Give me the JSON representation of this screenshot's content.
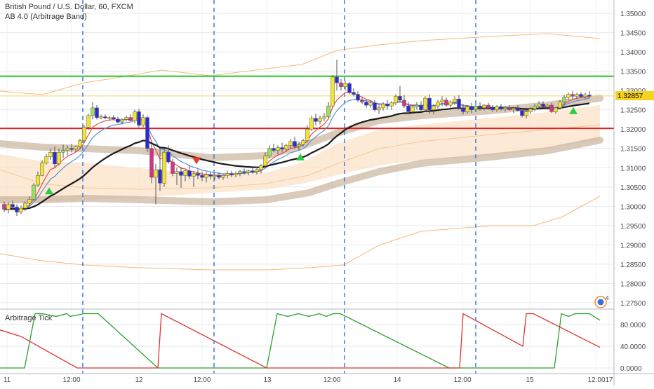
{
  "chart_data": [
    {
      "type": "candlestick",
      "title": "British Pound / U.S. Dollar, 60, FXCM",
      "study_label": "AB 4.0 (Arbitrage Band)",
      "ylim": [
        1.2735,
        1.3535
      ],
      "y_ticks": [
        "1.35000",
        "1.34500",
        "1.34000",
        "1.33500",
        "1.33000",
        "1.32500",
        "1.32000",
        "1.31500",
        "1.31000",
        "1.30500",
        "1.30000",
        "1.29500",
        "1.29000",
        "1.28500",
        "1.28000",
        "1.27500"
      ],
      "x_ticks": [
        "11",
        "12:00",
        "12",
        "12:00",
        "13",
        "12:00",
        "14",
        "12:00",
        "15",
        "12:00",
        "17"
      ],
      "last_price_label": "1.32857",
      "last_price": 1.32857,
      "horizontal_lines": [
        {
          "price": 1.3337,
          "color": "#22cc22"
        },
        {
          "price": 1.3202,
          "color": "#e02020"
        },
        {
          "price": 1.3286,
          "color": "#f5d66a"
        }
      ],
      "session_breaks_x": [
        118,
        305,
        491,
        678
      ],
      "signals": [
        {
          "type": "buy",
          "x": 70,
          "price": 1.304
        },
        {
          "type": "sell",
          "x": 280,
          "price": 1.3118
        },
        {
          "type": "buy",
          "x": 428,
          "price": 1.3128
        },
        {
          "type": "buy",
          "x": 817,
          "price": 1.3248
        }
      ],
      "candles_x": [
        6,
        12,
        18,
        24,
        30,
        36,
        42,
        48,
        54,
        60,
        66,
        72,
        78,
        84,
        90,
        96,
        102,
        108,
        114,
        120,
        126,
        132,
        138,
        144,
        150,
        156,
        162,
        168,
        174,
        180,
        186,
        192,
        198,
        204,
        210,
        216,
        222,
        228,
        234,
        240,
        246,
        252,
        258,
        264,
        270,
        276,
        282,
        288,
        294,
        300,
        306,
        312,
        318,
        324,
        330,
        336,
        342,
        348,
        354,
        360,
        366,
        372,
        378,
        384,
        390,
        396,
        402,
        408,
        414,
        420,
        426,
        432,
        438,
        444,
        450,
        456,
        462,
        468,
        474,
        480,
        486,
        492,
        498,
        504,
        510,
        516,
        522,
        528,
        534,
        540,
        546,
        552,
        558,
        564,
        570,
        576,
        582,
        588,
        594,
        600,
        606,
        612,
        618,
        624,
        630,
        636,
        642,
        648,
        654,
        660,
        666,
        672,
        678,
        684,
        690,
        696,
        702,
        708,
        714,
        720,
        726,
        732,
        738,
        744,
        750,
        756,
        762,
        768,
        774,
        780,
        786,
        792,
        798,
        804,
        810,
        816,
        822,
        828,
        834,
        840,
        846,
        852,
        858
      ],
      "ohlc": [
        [
          1.3005,
          1.3012,
          1.2985,
          1.2992
        ],
        [
          1.2992,
          1.301,
          1.2982,
          1.3005
        ],
        [
          1.3005,
          1.3015,
          1.299,
          1.2998
        ],
        [
          1.2998,
          1.3005,
          1.2975,
          1.2985
        ],
        [
          1.2985,
          1.3002,
          1.298,
          1.2995
        ],
        [
          1.2995,
          1.3012,
          1.2988,
          1.3008
        ],
        [
          1.3008,
          1.3025,
          1.3,
          1.3018
        ],
        [
          1.3018,
          1.306,
          1.3015,
          1.3055
        ],
        [
          1.3055,
          1.309,
          1.305,
          1.308
        ],
        [
          1.308,
          1.312,
          1.3078,
          1.3112
        ],
        [
          1.3112,
          1.3135,
          1.3108,
          1.3128
        ],
        [
          1.3128,
          1.315,
          1.312,
          1.314
        ],
        [
          1.314,
          1.3155,
          1.31,
          1.311
        ],
        [
          1.311,
          1.315,
          1.3105,
          1.314
        ],
        [
          1.314,
          1.316,
          1.3125,
          1.3145
        ],
        [
          1.3145,
          1.3158,
          1.3132,
          1.315
        ],
        [
          1.315,
          1.3162,
          1.314,
          1.3148
        ],
        [
          1.3148,
          1.3158,
          1.314,
          1.3155
        ],
        [
          1.3155,
          1.3175,
          1.3148,
          1.317
        ],
        [
          1.317,
          1.321,
          1.3165,
          1.3205
        ],
        [
          1.3205,
          1.324,
          1.3198,
          1.3235
        ],
        [
          1.3235,
          1.327,
          1.3225,
          1.3255
        ],
        [
          1.3255,
          1.3262,
          1.3225,
          1.323
        ],
        [
          1.323,
          1.3238,
          1.3225,
          1.3232
        ],
        [
          1.3232,
          1.3238,
          1.3226,
          1.3229
        ],
        [
          1.3229,
          1.3234,
          1.3222,
          1.323
        ],
        [
          1.323,
          1.3236,
          1.3224,
          1.3226
        ],
        [
          1.3226,
          1.3232,
          1.3215,
          1.3218
        ],
        [
          1.3218,
          1.3228,
          1.3212,
          1.3225
        ],
        [
          1.3225,
          1.3235,
          1.322,
          1.323
        ],
        [
          1.323,
          1.3238,
          1.322,
          1.3222
        ],
        [
          1.3222,
          1.325,
          1.3215,
          1.3245
        ],
        [
          1.3245,
          1.3252,
          1.3205,
          1.321
        ],
        [
          1.321,
          1.3238,
          1.3205,
          1.323
        ],
        [
          1.323,
          1.3235,
          1.314,
          1.315
        ],
        [
          1.315,
          1.316,
          1.306,
          1.3075
        ],
        [
          1.3075,
          1.311,
          1.3005,
          1.3095
        ],
        [
          1.3095,
          1.3148,
          1.304,
          1.306
        ],
        [
          1.306,
          1.315,
          1.305,
          1.314
        ],
        [
          1.314,
          1.3158,
          1.311,
          1.3115
        ],
        [
          1.3115,
          1.3122,
          1.3078,
          1.3085
        ],
        [
          1.3085,
          1.31,
          1.3055,
          1.309
        ],
        [
          1.309,
          1.3102,
          1.3048,
          1.308
        ],
        [
          1.308,
          1.3095,
          1.3065,
          1.3092
        ],
        [
          1.3092,
          1.3105,
          1.307,
          1.3078
        ],
        [
          1.3078,
          1.309,
          1.305,
          1.3085
        ],
        [
          1.3085,
          1.3095,
          1.307,
          1.308
        ],
        [
          1.308,
          1.309,
          1.3065,
          1.3075
        ],
        [
          1.3075,
          1.3088,
          1.3062,
          1.3082
        ],
        [
          1.3082,
          1.309,
          1.307,
          1.3078
        ],
        [
          1.3078,
          1.3085,
          1.3068,
          1.308
        ],
        [
          1.308,
          1.3088,
          1.307,
          1.3075
        ],
        [
          1.3075,
          1.3083,
          1.3068,
          1.308
        ],
        [
          1.308,
          1.3092,
          1.3072,
          1.3085
        ],
        [
          1.3085,
          1.3092,
          1.3075,
          1.3082
        ],
        [
          1.3082,
          1.309,
          1.3075,
          1.3085
        ],
        [
          1.3085,
          1.3095,
          1.3078,
          1.309
        ],
        [
          1.309,
          1.3098,
          1.3082,
          1.3088
        ],
        [
          1.3088,
          1.3095,
          1.308,
          1.3092
        ],
        [
          1.3092,
          1.31,
          1.3085,
          1.309
        ],
        [
          1.309,
          1.3102,
          1.3082,
          1.3095
        ],
        [
          1.3095,
          1.311,
          1.3085,
          1.3105
        ],
        [
          1.3105,
          1.314,
          1.31,
          1.313
        ],
        [
          1.313,
          1.3158,
          1.3125,
          1.315
        ],
        [
          1.315,
          1.3162,
          1.314,
          1.3145
        ],
        [
          1.3145,
          1.3158,
          1.3135,
          1.3152
        ],
        [
          1.3152,
          1.3165,
          1.314,
          1.3148
        ],
        [
          1.3148,
          1.3162,
          1.3142,
          1.3158
        ],
        [
          1.3158,
          1.3175,
          1.315,
          1.3168
        ],
        [
          1.3168,
          1.318,
          1.315,
          1.3155
        ],
        [
          1.3155,
          1.3168,
          1.3145,
          1.316
        ],
        [
          1.316,
          1.3175,
          1.3155,
          1.317
        ],
        [
          1.317,
          1.321,
          1.3165,
          1.32
        ],
        [
          1.32,
          1.3235,
          1.3195,
          1.3228
        ],
        [
          1.3228,
          1.324,
          1.321,
          1.322
        ],
        [
          1.322,
          1.3235,
          1.3212,
          1.3228
        ],
        [
          1.3228,
          1.3242,
          1.322,
          1.3232
        ],
        [
          1.3232,
          1.327,
          1.3228,
          1.326
        ],
        [
          1.326,
          1.334,
          1.3255,
          1.3335
        ],
        [
          1.3335,
          1.338,
          1.33,
          1.332
        ],
        [
          1.332,
          1.333,
          1.33,
          1.331
        ],
        [
          1.331,
          1.3325,
          1.33,
          1.3318
        ],
        [
          1.3318,
          1.3322,
          1.329,
          1.3295
        ],
        [
          1.3295,
          1.3305,
          1.3285,
          1.329
        ],
        [
          1.329,
          1.3298,
          1.327,
          1.3275
        ],
        [
          1.3275,
          1.3282,
          1.3265,
          1.327
        ],
        [
          1.327,
          1.3278,
          1.3255,
          1.3262
        ],
        [
          1.3262,
          1.3272,
          1.3255,
          1.3268
        ],
        [
          1.3268,
          1.3275,
          1.3245,
          1.325
        ],
        [
          1.325,
          1.3262,
          1.324,
          1.3255
        ],
        [
          1.3255,
          1.327,
          1.3248,
          1.3265
        ],
        [
          1.3265,
          1.3275,
          1.325,
          1.326
        ],
        [
          1.326,
          1.3272,
          1.325,
          1.3268
        ],
        [
          1.3268,
          1.329,
          1.3262,
          1.3285
        ],
        [
          1.3285,
          1.3312,
          1.327,
          1.3275
        ],
        [
          1.3275,
          1.3288,
          1.3255,
          1.326
        ],
        [
          1.326,
          1.327,
          1.3238,
          1.3245
        ],
        [
          1.3245,
          1.3262,
          1.324,
          1.3258
        ],
        [
          1.3258,
          1.327,
          1.325,
          1.3262
        ],
        [
          1.3262,
          1.3272,
          1.3245,
          1.325
        ],
        [
          1.325,
          1.3285,
          1.3245,
          1.328
        ],
        [
          1.328,
          1.329,
          1.324,
          1.325
        ],
        [
          1.325,
          1.3265,
          1.3238,
          1.326
        ],
        [
          1.326,
          1.3275,
          1.3252,
          1.327
        ],
        [
          1.327,
          1.3285,
          1.326,
          1.3275
        ],
        [
          1.3275,
          1.3282,
          1.3258,
          1.3262
        ],
        [
          1.3262,
          1.3275,
          1.3255,
          1.327
        ],
        [
          1.327,
          1.3285,
          1.3262,
          1.3278
        ],
        [
          1.3278,
          1.3288,
          1.325,
          1.3255
        ],
        [
          1.3255,
          1.3265,
          1.3238,
          1.3245
        ],
        [
          1.3245,
          1.3262,
          1.324,
          1.3258
        ],
        [
          1.3258,
          1.3268,
          1.3242,
          1.325
        ],
        [
          1.325,
          1.3265,
          1.3245,
          1.326
        ],
        [
          1.326,
          1.327,
          1.3248,
          1.3255
        ],
        [
          1.3255,
          1.3265,
          1.3248,
          1.3262
        ],
        [
          1.3262,
          1.3268,
          1.325,
          1.3255
        ],
        [
          1.3255,
          1.3262,
          1.3245,
          1.325
        ],
        [
          1.325,
          1.3262,
          1.3245,
          1.3258
        ],
        [
          1.3258,
          1.3265,
          1.3248,
          1.3252
        ],
        [
          1.3252,
          1.326,
          1.3245,
          1.3256
        ],
        [
          1.3256,
          1.3262,
          1.3248,
          1.325
        ],
        [
          1.325,
          1.3258,
          1.3242,
          1.3254
        ],
        [
          1.3254,
          1.3262,
          1.3246,
          1.3248
        ],
        [
          1.3248,
          1.3255,
          1.323,
          1.3235
        ],
        [
          1.3235,
          1.325,
          1.3228,
          1.3245
        ],
        [
          1.3245,
          1.3258,
          1.324,
          1.3252
        ],
        [
          1.3252,
          1.3265,
          1.3246,
          1.326
        ],
        [
          1.326,
          1.3272,
          1.3252,
          1.3265
        ],
        [
          1.3265,
          1.3272,
          1.3255,
          1.3258
        ],
        [
          1.3258,
          1.3265,
          1.325,
          1.3262
        ],
        [
          1.3262,
          1.3268,
          1.3242,
          1.3245
        ],
        [
          1.3245,
          1.3258,
          1.324,
          1.3255
        ],
        [
          1.3255,
          1.3275,
          1.325,
          1.327
        ],
        [
          1.327,
          1.3288,
          1.3262,
          1.3282
        ],
        [
          1.3282,
          1.3295,
          1.3275,
          1.329
        ],
        [
          1.329,
          1.3298,
          1.3278,
          1.3285
        ],
        [
          1.3285,
          1.3294,
          1.3278,
          1.329
        ],
        [
          1.329,
          1.3296,
          1.328,
          1.3284
        ],
        [
          1.3284,
          1.3294,
          1.3278,
          1.3288
        ],
        [
          1.3288,
          1.3298,
          1.328,
          1.3286
        ]
      ]
    },
    {
      "type": "line",
      "title": "Arbitrage Tick",
      "ylim": [
        -5,
        100
      ],
      "y_ticks": [
        "80.0000",
        "40.0000",
        "0.0000"
      ],
      "series": [
        {
          "color": "#2aa02a",
          "x": [
            0,
            35,
            50,
            60,
            80,
            95,
            100,
            120,
            140,
            225,
            380,
            395,
            410,
            425,
            440,
            455,
            465,
            475,
            485,
            640,
            655,
            660,
            675,
            690,
            700,
            710,
            790,
            800,
            810,
            820,
            840,
            855
          ],
          "values": [
            0,
            0,
            100,
            100,
            95,
            100,
            95,
            100,
            100,
            0,
            0,
            100,
            95,
            100,
            95,
            100,
            95,
            100,
            100,
            0,
            0,
            0,
            0,
            0,
            0,
            0,
            0,
            100,
            95,
            100,
            100,
            88
          ]
        },
        {
          "color": "#dd3333",
          "x": [
            0,
            30,
            110,
            225,
            230,
            380,
            385,
            395,
            490,
            650,
            655,
            660,
            745,
            750,
            760,
            855
          ],
          "values": [
            70,
            58,
            0,
            0,
            100,
            0,
            0,
            0,
            0,
            0,
            0,
            100,
            40,
            100,
            100,
            38
          ]
        }
      ]
    }
  ]
}
